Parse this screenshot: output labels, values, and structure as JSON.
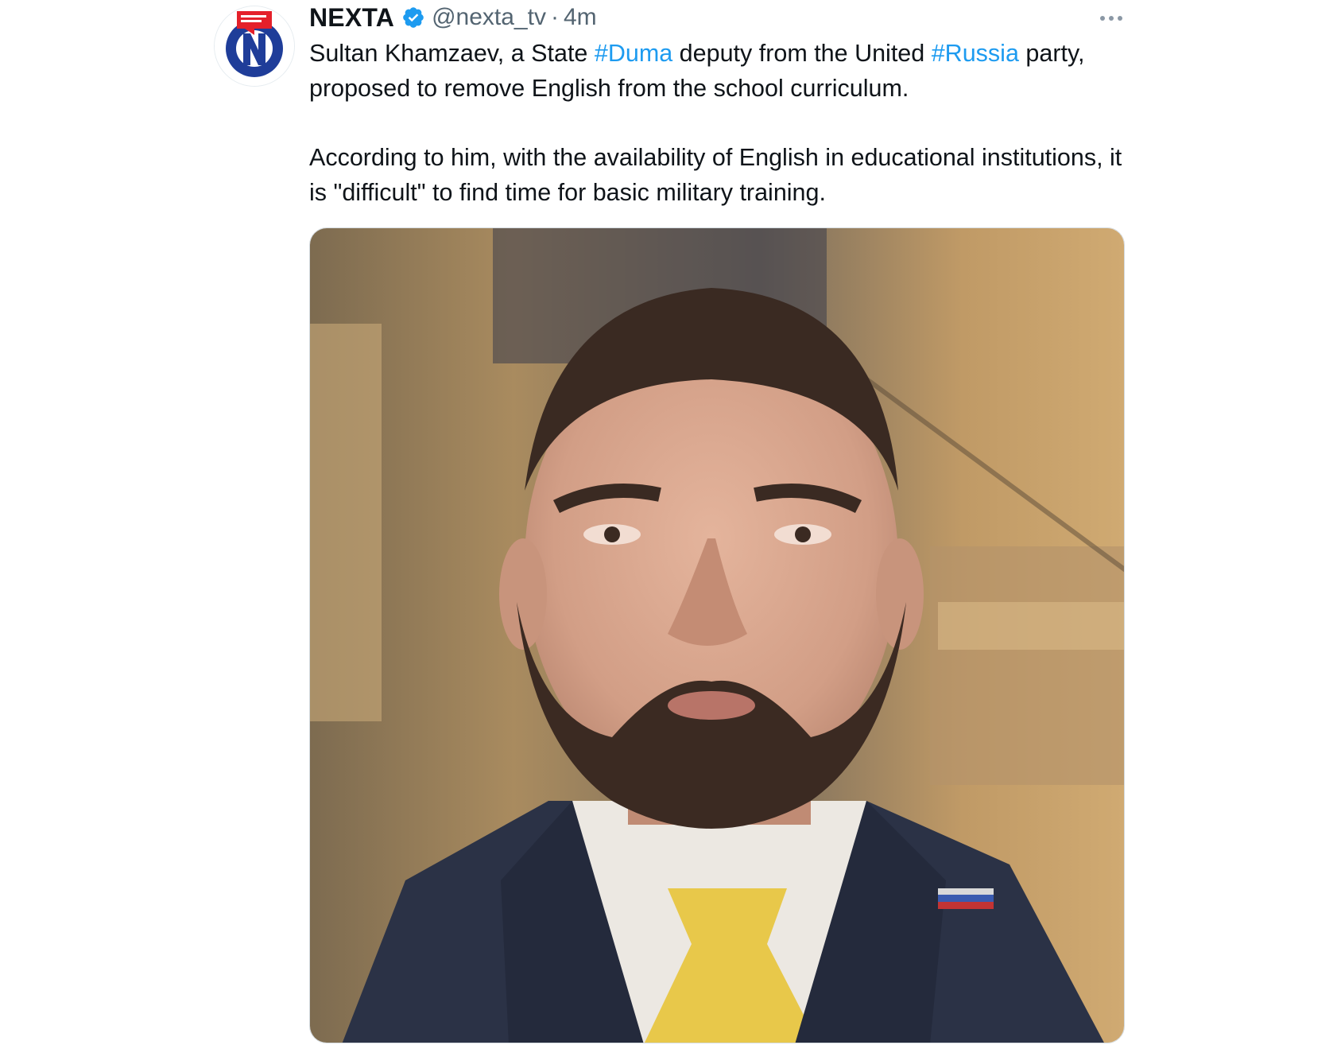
{
  "tweet": {
    "author_name": "NEXTA",
    "handle": "@nexta_tv",
    "separator": "·",
    "time": "4m",
    "paragraph1": {
      "pre": "Sultan Khamzaev, a State ",
      "tag1": "#Duma",
      "mid": " deputy from the United ",
      "tag2": "#Russia",
      "post": " party, proposed to remove English from the school curriculum."
    },
    "paragraph2": "According to him, with the availability of English in educational institutions, it is \"difficult\" to find time for basic military training.",
    "icons": {
      "verified": "verified-badge-icon",
      "more": "more-options-icon"
    },
    "media": {
      "type": "photo",
      "subject": "man with beard in suit and yellow tie"
    }
  },
  "colors": {
    "text": "#0f1419",
    "secondary": "#536471",
    "link": "#1d9bf0",
    "verified": "#1d9bf0",
    "logo_red": "#e4202a",
    "logo_blue": "#1f3d99"
  }
}
